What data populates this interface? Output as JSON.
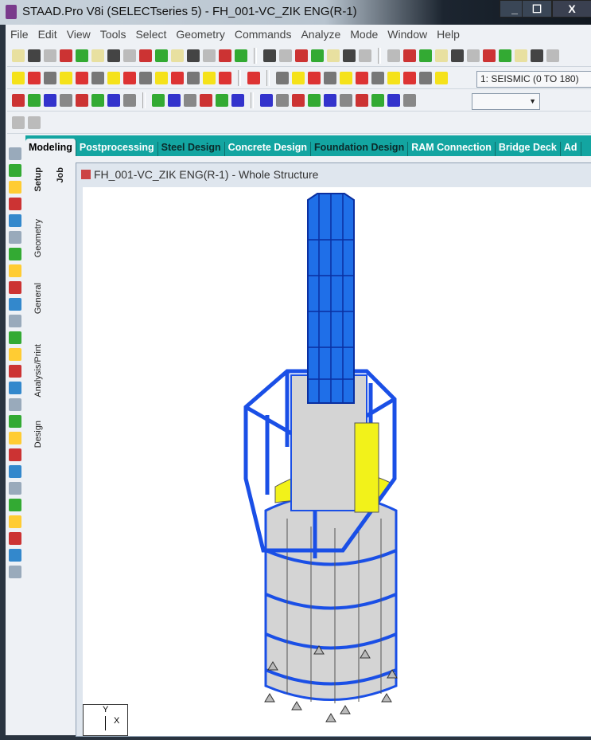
{
  "window": {
    "title": "STAAD.Pro V8i (SELECTseries 5) - FH_001-VC_ZIK ENG(R-1)",
    "buttons": [
      "_",
      "☐",
      "X"
    ]
  },
  "menu": [
    "File",
    "Edit",
    "View",
    "Tools",
    "Select",
    "Geometry",
    "Commands",
    "Analyze",
    "Mode",
    "Window",
    "Help"
  ],
  "toolbar": {
    "load_case": "1: SEISMIC (0 TO 180)",
    "empty_combo": ""
  },
  "tabs": [
    {
      "label": "Modeling",
      "active": true
    },
    {
      "label": "Postprocessing"
    },
    {
      "label": "Steel Design"
    },
    {
      "label": "Concrete Design"
    },
    {
      "label": "Foundation Design"
    },
    {
      "label": "RAM Connection"
    },
    {
      "label": "Bridge Deck"
    },
    {
      "label": "Ad"
    }
  ],
  "side_tabs": [
    "Setup",
    "Geometry",
    "General",
    "Analysis/Print",
    "Design"
  ],
  "job_tab": "Job",
  "document": {
    "title": "FH_001-VC_ZIK ENG(R-1) - Whole Structure"
  },
  "axes": {
    "y": "Y",
    "x": "X"
  },
  "colors": {
    "tab_bar": "#13a5a1",
    "member": "#1a4fe6",
    "plate": "#d4d4d4",
    "highlight": "#f2f21a"
  }
}
